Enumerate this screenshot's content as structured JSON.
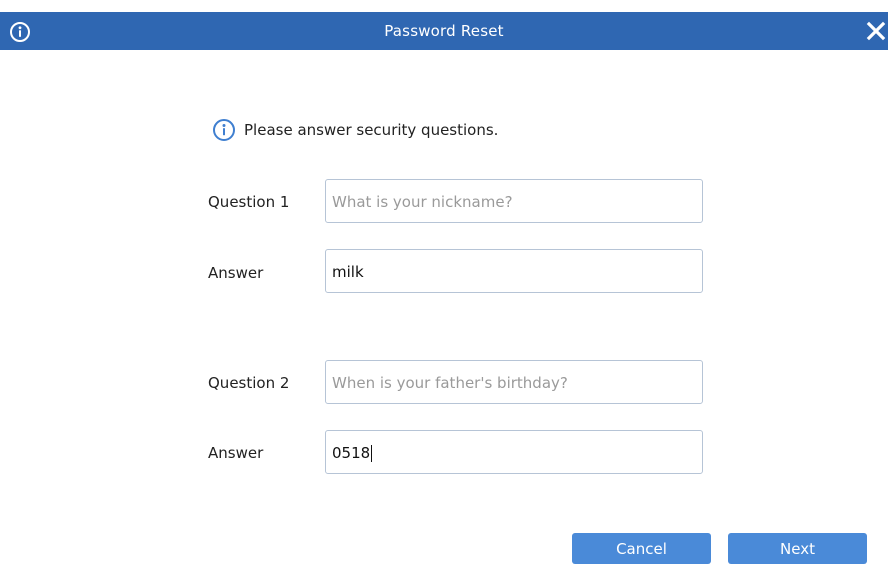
{
  "window": {
    "title": "Password Reset"
  },
  "hint": {
    "text": "Please answer security questions."
  },
  "form": {
    "q1": {
      "label": "Question 1",
      "question": "What is your nickname?"
    },
    "a1": {
      "label": "Answer",
      "value": "milk"
    },
    "q2": {
      "label": "Question 2",
      "question": "When is your father's birthday?"
    },
    "a2": {
      "label": "Answer",
      "value": "0518"
    }
  },
  "buttons": {
    "cancel": "Cancel",
    "next": "Next"
  },
  "colors": {
    "titlebar": "#2f67b2",
    "button": "#4a8ad8",
    "field_border": "#b6c4d6",
    "info_icon": "#3f7fd0"
  },
  "icons": {
    "title_icon": "info-circle",
    "close": "close-x",
    "hint_icon": "info-circle"
  }
}
